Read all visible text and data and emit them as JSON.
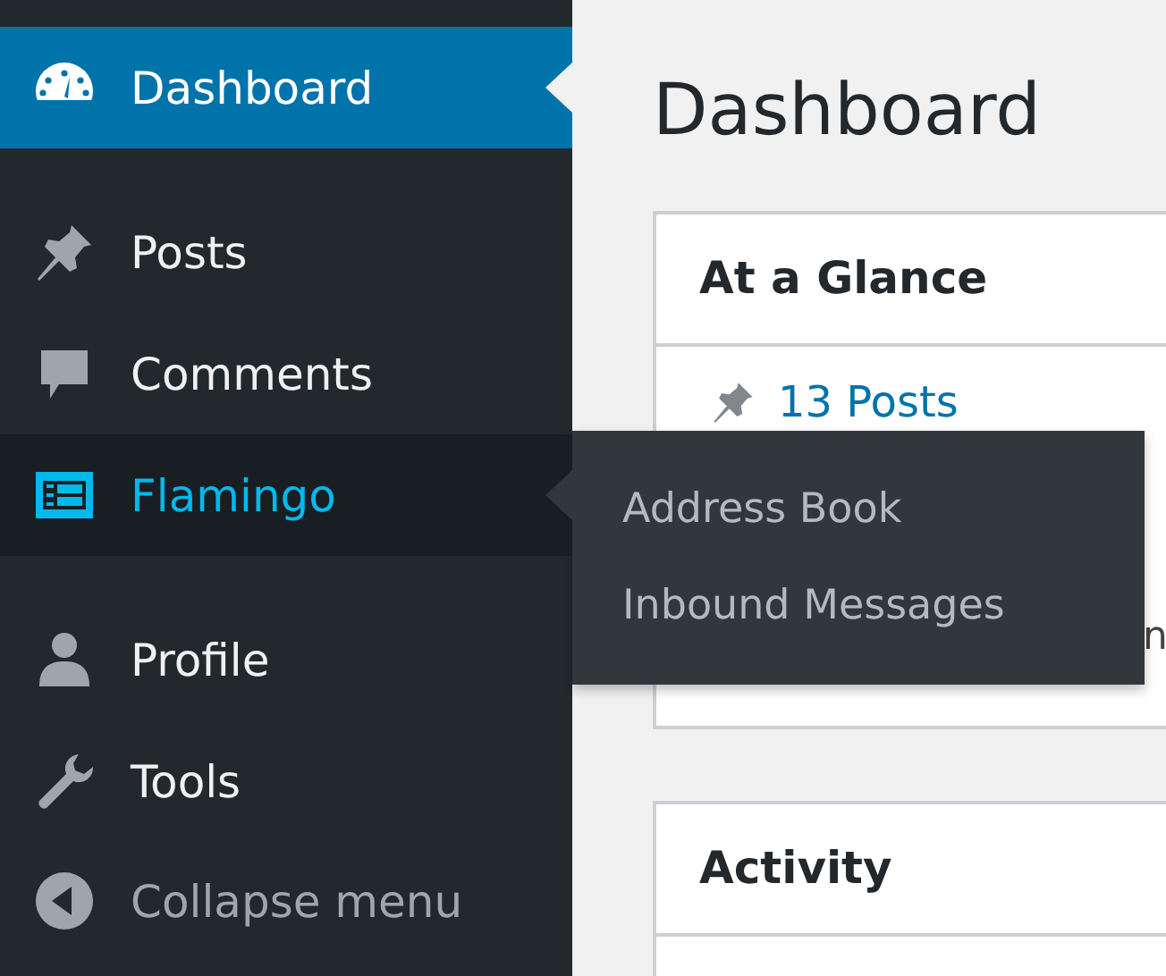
{
  "sidebar": {
    "groups": [
      {
        "items": [
          {
            "label": "Dashboard",
            "selected": true,
            "open": false
          }
        ]
      },
      {
        "items": [
          {
            "label": "Posts",
            "selected": false,
            "open": false
          },
          {
            "label": "Comments",
            "selected": false,
            "open": false
          },
          {
            "label": "Flamingo",
            "selected": false,
            "open": true,
            "submenu": [
              {
                "label": "Address Book"
              },
              {
                "label": "Inbound Messages"
              }
            ]
          }
        ]
      },
      {
        "items": [
          {
            "label": "Profile",
            "selected": false,
            "open": false
          },
          {
            "label": "Tools",
            "selected": false,
            "open": false
          }
        ]
      }
    ],
    "collapse": {
      "label": "Collapse menu"
    }
  },
  "page": {
    "title": "Dashboard",
    "cards": [
      {
        "title": "At a Glance",
        "links": [
          {
            "label": "13 Posts"
          }
        ],
        "cut_text": "n"
      },
      {
        "title": "Activity"
      }
    ]
  }
}
